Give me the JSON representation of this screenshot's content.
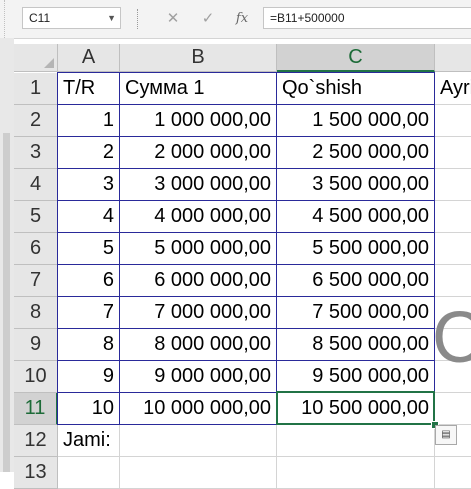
{
  "formula_bar": {
    "name_box": "C11",
    "cancel_glyph": "✕",
    "enter_glyph": "✓",
    "fx_glyph": "fx",
    "formula": "=B11+500000"
  },
  "columns": [
    {
      "letter": "A"
    },
    {
      "letter": "B"
    },
    {
      "letter": "C",
      "active": true
    }
  ],
  "rows": [
    {
      "num": "1",
      "a": "T/R",
      "b": "Сумма 1",
      "c": "Qo`shish",
      "d": "Ayri"
    },
    {
      "num": "2",
      "a": "1",
      "b": "1 000 000,00",
      "c": "1 500 000,00",
      "d": ""
    },
    {
      "num": "3",
      "a": "2",
      "b": "2 000 000,00",
      "c": "2 500 000,00",
      "d": ""
    },
    {
      "num": "4",
      "a": "3",
      "b": "3 000 000,00",
      "c": "3 500 000,00",
      "d": ""
    },
    {
      "num": "5",
      "a": "4",
      "b": "4 000 000,00",
      "c": "4 500 000,00",
      "d": ""
    },
    {
      "num": "6",
      "a": "5",
      "b": "5 000 000,00",
      "c": "5 500 000,00",
      "d": ""
    },
    {
      "num": "7",
      "a": "6",
      "b": "6 000 000,00",
      "c": "6 500 000,00",
      "d": ""
    },
    {
      "num": "8",
      "a": "7",
      "b": "7 000 000,00",
      "c": "7 500 000,00",
      "d": ""
    },
    {
      "num": "9",
      "a": "8",
      "b": "8 000 000,00",
      "c": "8 500 000,00",
      "d": ""
    },
    {
      "num": "10",
      "a": "9",
      "b": "9 000 000,00",
      "c": "9 500 000,00",
      "d": ""
    },
    {
      "num": "11",
      "a": "10",
      "b": "10 000 000,00",
      "c": "10 500 000,00",
      "d": ""
    },
    {
      "num": "12",
      "a": "Jami:",
      "b": "",
      "c": "",
      "d": ""
    },
    {
      "num": "13",
      "a": "",
      "b": "",
      "c": "",
      "d": ""
    }
  ],
  "selected_cell": "C11",
  "overlay_glyph": "C",
  "colors": {
    "accent": "#217346",
    "table_border": "#2a2a9a"
  }
}
